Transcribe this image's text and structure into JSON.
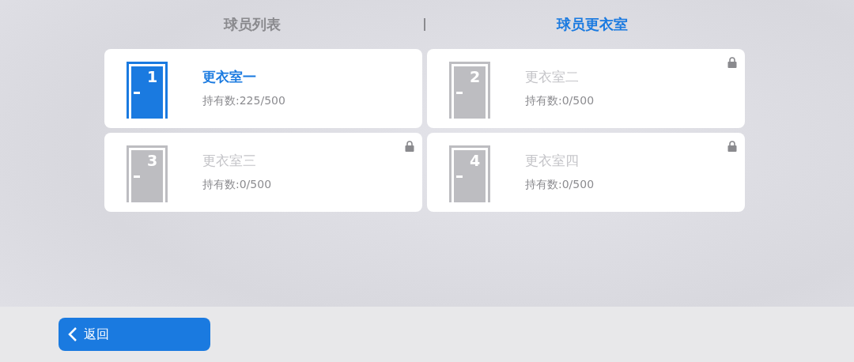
{
  "tabs": [
    {
      "label": "球员列表",
      "selected": false
    },
    {
      "label": "球员更衣室",
      "selected": true
    }
  ],
  "rooms": [
    {
      "number": "1",
      "name": "更衣室一",
      "count": "持有数:225/500",
      "selected": true,
      "locked": false
    },
    {
      "number": "2",
      "name": "更衣室二",
      "count": "持有数:0/500",
      "selected": false,
      "locked": true
    },
    {
      "number": "3",
      "name": "更衣室三",
      "count": "持有数:0/500",
      "selected": false,
      "locked": true
    },
    {
      "number": "4",
      "name": "更衣室四",
      "count": "持有数:0/500",
      "selected": false,
      "locked": true
    }
  ],
  "back_button": {
    "label": "返回"
  }
}
